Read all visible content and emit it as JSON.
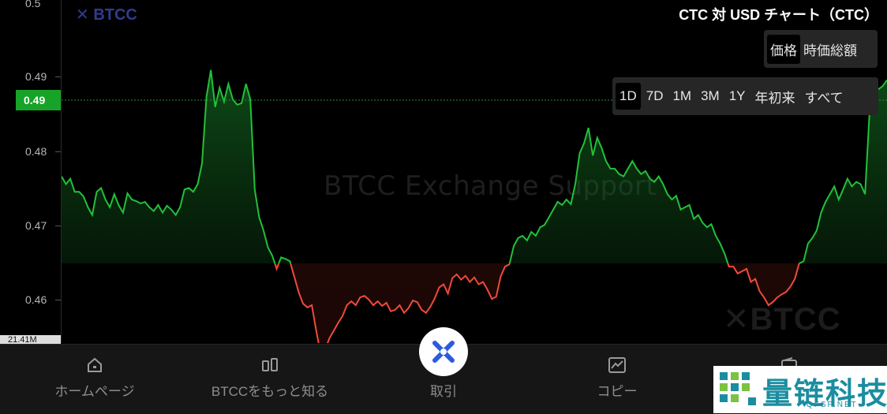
{
  "header": {
    "brand": "BTCC",
    "title": "CTC 対 USD チャート（CTC）"
  },
  "mode_toggle": [
    "価格",
    "時価総額"
  ],
  "mode_active": 0,
  "ranges": [
    "1D",
    "7D",
    "1M",
    "3M",
    "1Y",
    "年初来",
    "すべて"
  ],
  "range_active": 0,
  "current_price": "0.49",
  "volume_label": "21.41M",
  "watermark": "BTCC Exchange Support",
  "watermark_logo": "BTCC",
  "chart_data": {
    "type": "line",
    "yticks": [
      "0.5",
      "0.49",
      "0.48",
      "0.47",
      "0.46"
    ],
    "ylim": [
      0.4555,
      0.5
    ],
    "baseline": 0.4652,
    "colors": {
      "up": "#22c03a",
      "down": "#f04a3a"
    },
    "values": [
      0.4765,
      0.4755,
      0.4762,
      0.4745,
      0.4745,
      0.4739,
      0.4725,
      0.4715,
      0.4745,
      0.475,
      0.4735,
      0.4725,
      0.4742,
      0.4728,
      0.4718,
      0.4743,
      0.4735,
      0.4733,
      0.473,
      0.4732,
      0.4725,
      0.472,
      0.4728,
      0.4718,
      0.4727,
      0.4722,
      0.4715,
      0.4725,
      0.4748,
      0.475,
      0.4745,
      0.4755,
      0.4782,
      0.4868,
      0.4903,
      0.4855,
      0.488,
      0.4862,
      0.4885,
      0.4865,
      0.4858,
      0.486,
      0.4885,
      0.4865,
      0.4748,
      0.4712,
      0.4695,
      0.4673,
      0.4662,
      0.4645,
      0.466,
      0.4658,
      0.4655,
      0.4635,
      0.4615,
      0.46,
      0.4595,
      0.4598,
      0.4565,
      0.4535,
      0.454,
      0.4555,
      0.4565,
      0.4575,
      0.4584,
      0.4598,
      0.4603,
      0.4598,
      0.4608,
      0.461,
      0.4605,
      0.4598,
      0.4603,
      0.4597,
      0.4601,
      0.459,
      0.4592,
      0.4598,
      0.4588,
      0.4594,
      0.4604,
      0.4602,
      0.4592,
      0.4588,
      0.4596,
      0.4607,
      0.4621,
      0.4625,
      0.4613,
      0.4633,
      0.4638,
      0.4631,
      0.4636,
      0.4628,
      0.4634,
      0.4625,
      0.4628,
      0.4618,
      0.4606,
      0.4609,
      0.4635,
      0.4648,
      0.4651,
      0.4675,
      0.4685,
      0.4688,
      0.4682,
      0.4693,
      0.4688,
      0.4699,
      0.4702,
      0.4712,
      0.4722,
      0.4732,
      0.4728,
      0.4735,
      0.4729,
      0.4755,
      0.4795,
      0.4808,
      0.4828,
      0.4792,
      0.4815,
      0.4802,
      0.4785,
      0.4775,
      0.4775,
      0.4768,
      0.4765,
      0.4775,
      0.4785,
      0.4775,
      0.4768,
      0.4772,
      0.4762,
      0.4758,
      0.4765,
      0.4755,
      0.4742,
      0.4735,
      0.474,
      0.4722,
      0.4725,
      0.4728,
      0.471,
      0.4715,
      0.4705,
      0.4699,
      0.4703,
      0.4688,
      0.4678,
      0.4665,
      0.4648,
      0.4648,
      0.4639,
      0.4642,
      0.4645,
      0.4628,
      0.4632,
      0.4616,
      0.4608,
      0.4598,
      0.4602,
      0.4608,
      0.4612,
      0.4615,
      0.4622,
      0.4632,
      0.4652,
      0.4655,
      0.4678,
      0.4685,
      0.4695,
      0.4718,
      0.4732,
      0.4742,
      0.4752,
      0.4735,
      0.4748,
      0.4762,
      0.4752,
      0.4758,
      0.4755,
      0.4742,
      0.4845,
      0.4875,
      0.4878,
      0.4882,
      0.489
    ]
  },
  "bottom_nav": [
    {
      "label": "ホームページ",
      "icon": "home-icon"
    },
    {
      "label": "BTCCをもっと知る",
      "icon": "panels-icon"
    },
    {
      "label": "取引",
      "icon": "trade-x-icon"
    },
    {
      "label": "コピー",
      "icon": "chart-card-icon"
    },
    {
      "label": "",
      "icon": "wallet-icon"
    }
  ],
  "corner_logo": {
    "text": "量链科技",
    "domain": "QFSP.NET"
  }
}
